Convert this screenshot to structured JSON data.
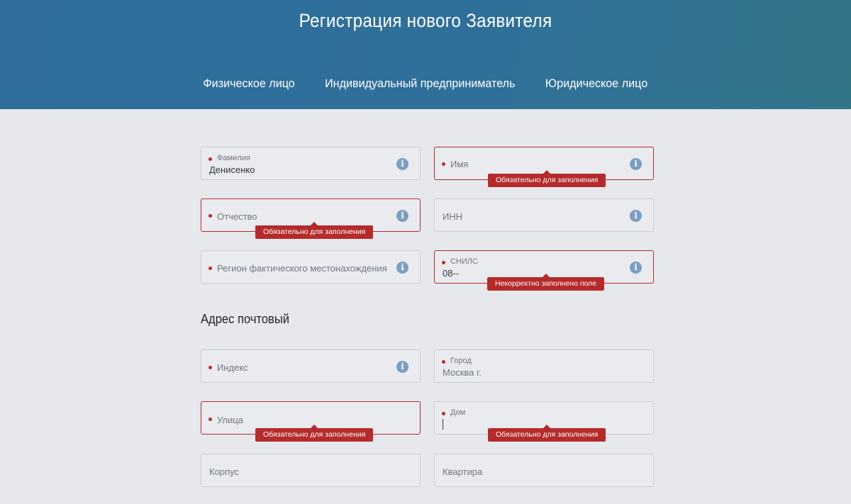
{
  "header": {
    "title": "Регистрация нового Заявителя",
    "tabs": [
      "Физическое лицо",
      "Индивидуальный предприниматель",
      "Юридическое лицо"
    ]
  },
  "form": {
    "surname": {
      "label": "Фамилия",
      "value": "Денисенко"
    },
    "name": {
      "label": "Имя",
      "error": "Обязательно для заполнения"
    },
    "patronymic": {
      "label": "Отчество",
      "error": "Обязательно для заполнения"
    },
    "inn": {
      "label": "ИНН"
    },
    "region": {
      "label": "Регион фактического местонахождения"
    },
    "snils": {
      "label": "СНИЛС",
      "value": "08--",
      "error": "Некорректно заполнено поле"
    }
  },
  "postal": {
    "title": "Адрес почтовый",
    "index": {
      "label": "Индекс"
    },
    "city": {
      "label": "Город",
      "value": "Москва г."
    },
    "street": {
      "label": "Улица",
      "error": "Обязательно для заполнения"
    },
    "house": {
      "label": "Дом",
      "error": "Обязательно для заполнения"
    },
    "building": {
      "label": "Корпус"
    },
    "apartment": {
      "label": "Квартира"
    }
  },
  "icons": {
    "info": "info-icon"
  },
  "colors": {
    "header": "#2e6d9c",
    "error": "#b52b2b",
    "info_icon": "#7b9ec2",
    "background": "#e6e8ec"
  }
}
